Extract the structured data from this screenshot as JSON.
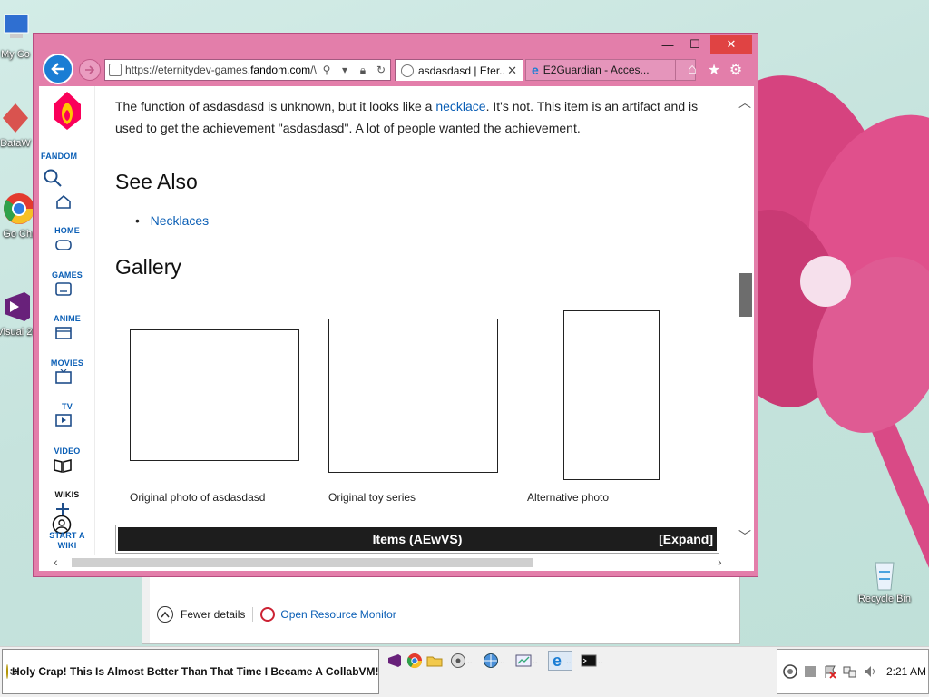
{
  "desktop": {
    "icons": [
      {
        "label": "My Co",
        "icon": "computer-icon"
      },
      {
        "label": "DataW",
        "icon": "dataw-icon"
      },
      {
        "label": "Go Chr",
        "icon": "chrome-icon"
      },
      {
        "label": "Visual 20",
        "icon": "visual-studio-icon"
      },
      {
        "label": "Recycle Bin",
        "icon": "recycle-bin-icon"
      }
    ]
  },
  "task_manager": {
    "fewer_details": "Fewer details",
    "open_resource_monitor": "Open Resource Monitor"
  },
  "browser": {
    "address": {
      "prefix": "https://eternitydev-games.",
      "domain": "fandom.com",
      "suffix": "/\\"
    },
    "tabs": [
      {
        "title": "asdasdasd | Eter...",
        "active": true
      },
      {
        "title": "E2Guardian - Acces...",
        "active": false
      }
    ],
    "caption": {
      "minimize": "—",
      "maximize": "☐",
      "close": "✕"
    }
  },
  "fandom_rail": {
    "brand": "FANDOM",
    "items": [
      {
        "label": "HOME",
        "icon": "home-icon"
      },
      {
        "label": "GAMES",
        "icon": "gamepad-icon"
      },
      {
        "label": "ANIME",
        "icon": "anime-icon"
      },
      {
        "label": "MOVIES",
        "icon": "movies-icon"
      },
      {
        "label": "TV",
        "icon": "tv-icon"
      },
      {
        "label": "VIDEO",
        "icon": "video-icon"
      },
      {
        "label": "WIKIS",
        "icon": "wikis-icon"
      },
      {
        "label": "START A WIKI",
        "icon": "plus-icon"
      }
    ]
  },
  "article": {
    "para_part1": "The function of asdasdasd is unknown, but it looks like a ",
    "para_link": "necklace",
    "para_part2": ". It's not. This item is an artifact and is used to get the achievement \"asdasdasd\". A lot of people wanted the achievement.",
    "see_also_heading": "See Also",
    "see_also_link": "Necklaces",
    "gallery_heading": "Gallery",
    "gallery": [
      {
        "caption": "Original photo of asdasdasd"
      },
      {
        "caption": "Original toy series"
      },
      {
        "caption": "Alternative photo"
      }
    ],
    "navbox_title": "Items (AEwVS)",
    "navbox_expand": "[Expand]"
  },
  "taskbar": {
    "banner": "Holy Crap! This Is Almost Better Than That Time I Became A CollabVM!",
    "time": "2:21 AM"
  }
}
